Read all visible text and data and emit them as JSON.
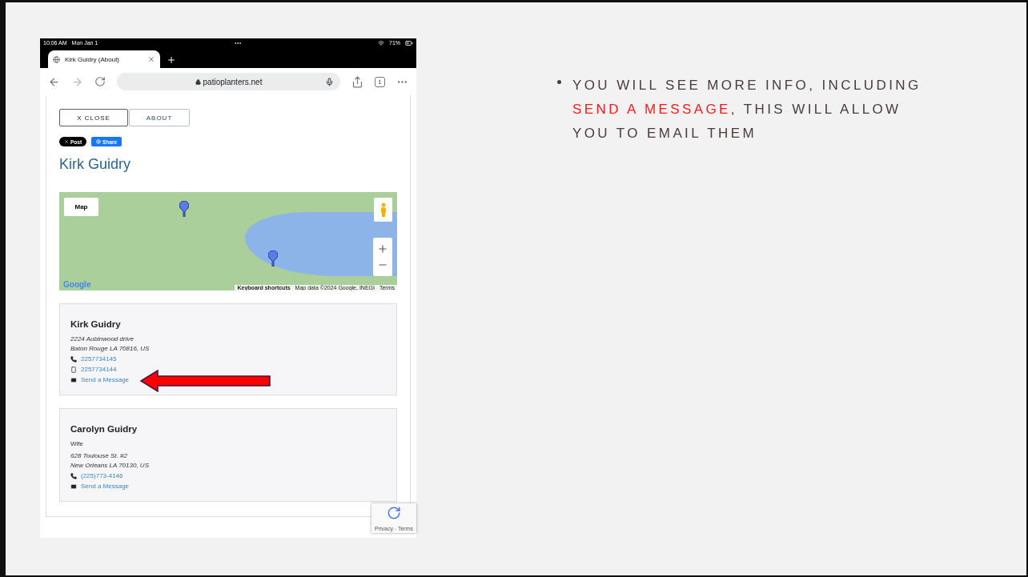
{
  "slide": {
    "bullet": [
      {
        "text": "YOU WILL SEE MORE INFO, INCLUDING ",
        "highlight": false
      },
      {
        "text": "SEND A MESSAGE",
        "highlight": true
      },
      {
        "text": ", THIS WILL ALLOW YOU TO EMAIL THEM",
        "highlight": false
      }
    ]
  },
  "device": {
    "status_bar": {
      "time": "10:06 AM",
      "date": "Mon Jan 1",
      "battery": "71%"
    },
    "tab": {
      "title": "Kirk Guidry (About)"
    },
    "address_bar": {
      "url": "patioplanters.net"
    },
    "tab_count": "1"
  },
  "page": {
    "buttons": [
      {
        "label": "X CLOSE",
        "selected": true
      },
      {
        "label": "ABOUT",
        "selected": false
      }
    ],
    "social": [
      {
        "kind": "x",
        "label": "Post"
      },
      {
        "kind": "facebook",
        "label": "Share"
      }
    ],
    "title": "Kirk Guidry",
    "map": {
      "type_button": "Map",
      "logo": "Google",
      "shortcuts": "Keyboard shortcuts",
      "attribution": "Map data ©2024 Google, INEGI",
      "terms": "Terms"
    },
    "contacts": [
      {
        "name": "Kirk Guidry",
        "address": [
          "2224 Aubinwood drive",
          "Baton Rouge LA 70816, US"
        ],
        "phones": [
          {
            "kind": "phone",
            "number": "2257734145"
          },
          {
            "kind": "mobile",
            "number": "2257734144"
          }
        ],
        "message": "Send a Message"
      },
      {
        "name": "Carolyn Guidry",
        "relation": "Wife",
        "address": [
          "628 Toulouse St. #2",
          "New Orleans LA 70130, US"
        ],
        "phones": [
          {
            "kind": "phone",
            "number": "(225)773-4146"
          }
        ],
        "message": "Send a Message"
      }
    ],
    "recaptcha": "Privacy - Terms"
  }
}
